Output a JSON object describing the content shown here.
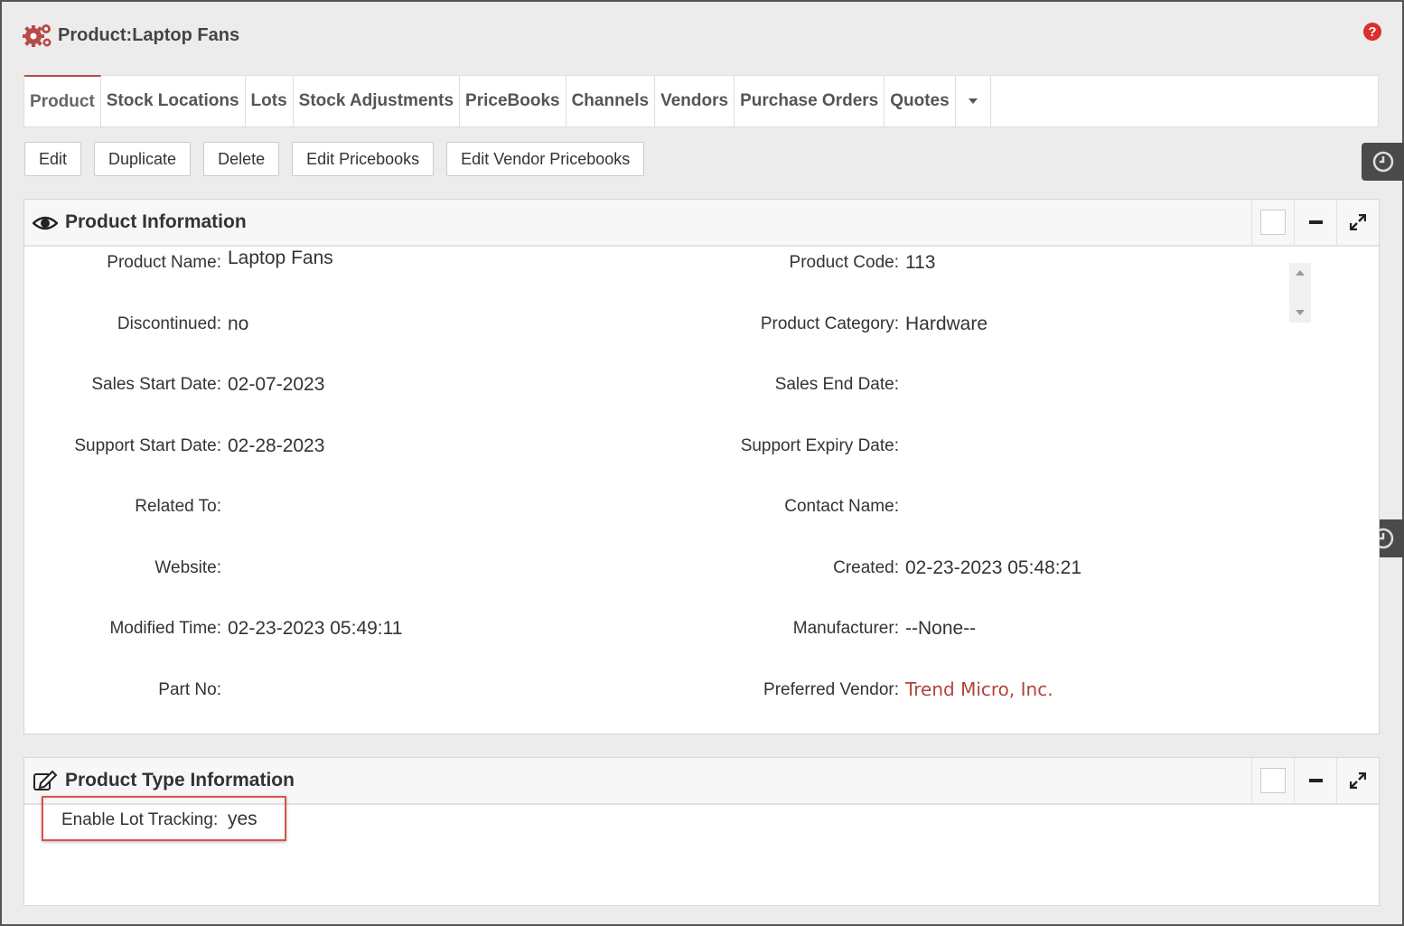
{
  "header": {
    "title": "Product:Laptop Fans",
    "icon": "gears-icon",
    "help_icon": "help-icon",
    "accent_color": "#b94a48"
  },
  "tabs": [
    {
      "label": "Product",
      "active": true
    },
    {
      "label": "Stock Locations"
    },
    {
      "label": "Lots"
    },
    {
      "label": "Stock Adjustments"
    },
    {
      "label": "PriceBooks"
    },
    {
      "label": "Channels"
    },
    {
      "label": "Vendors"
    },
    {
      "label": "Purchase Orders"
    },
    {
      "label": "Quotes"
    }
  ],
  "actions": {
    "edit": "Edit",
    "duplicate": "Duplicate",
    "delete": "Delete",
    "edit_pricebooks": "Edit Pricebooks",
    "edit_vendor_pricebooks": "Edit Vendor Pricebooks"
  },
  "product_info": {
    "title": "Product Information",
    "icon": "eye-icon",
    "left": [
      {
        "label": "Product Name:",
        "value": "Laptop Fans"
      },
      {
        "label": "Discontinued:",
        "value": "no"
      },
      {
        "label": "Sales Start Date:",
        "value": "02-07-2023"
      },
      {
        "label": "Support Start Date:",
        "value": "02-28-2023"
      },
      {
        "label": "Related To:",
        "value": ""
      },
      {
        "label": "Website:",
        "value": ""
      },
      {
        "label": "Modified Time:",
        "value": "02-23-2023 05:49:11"
      },
      {
        "label": "Part No:",
        "value": ""
      }
    ],
    "right": [
      {
        "label": "Product Code:",
        "value": "113"
      },
      {
        "label": "Product Category:",
        "value": "Hardware"
      },
      {
        "label": "Sales End Date:",
        "value": ""
      },
      {
        "label": "Support Expiry Date:",
        "value": ""
      },
      {
        "label": "Contact Name:",
        "value": ""
      },
      {
        "label": "Created:",
        "value": "02-23-2023 05:48:21"
      },
      {
        "label": "Manufacturer:",
        "value": "--None--"
      },
      {
        "label": "Preferred Vendor:",
        "value": "Trend Micro, Inc.",
        "link": true
      }
    ]
  },
  "product_type": {
    "title": "Product Type Information",
    "icon": "edit-icon",
    "fields": [
      {
        "label": "Enable Lot Tracking:",
        "value": "yes"
      }
    ],
    "highlight_color": "#d9534f"
  }
}
